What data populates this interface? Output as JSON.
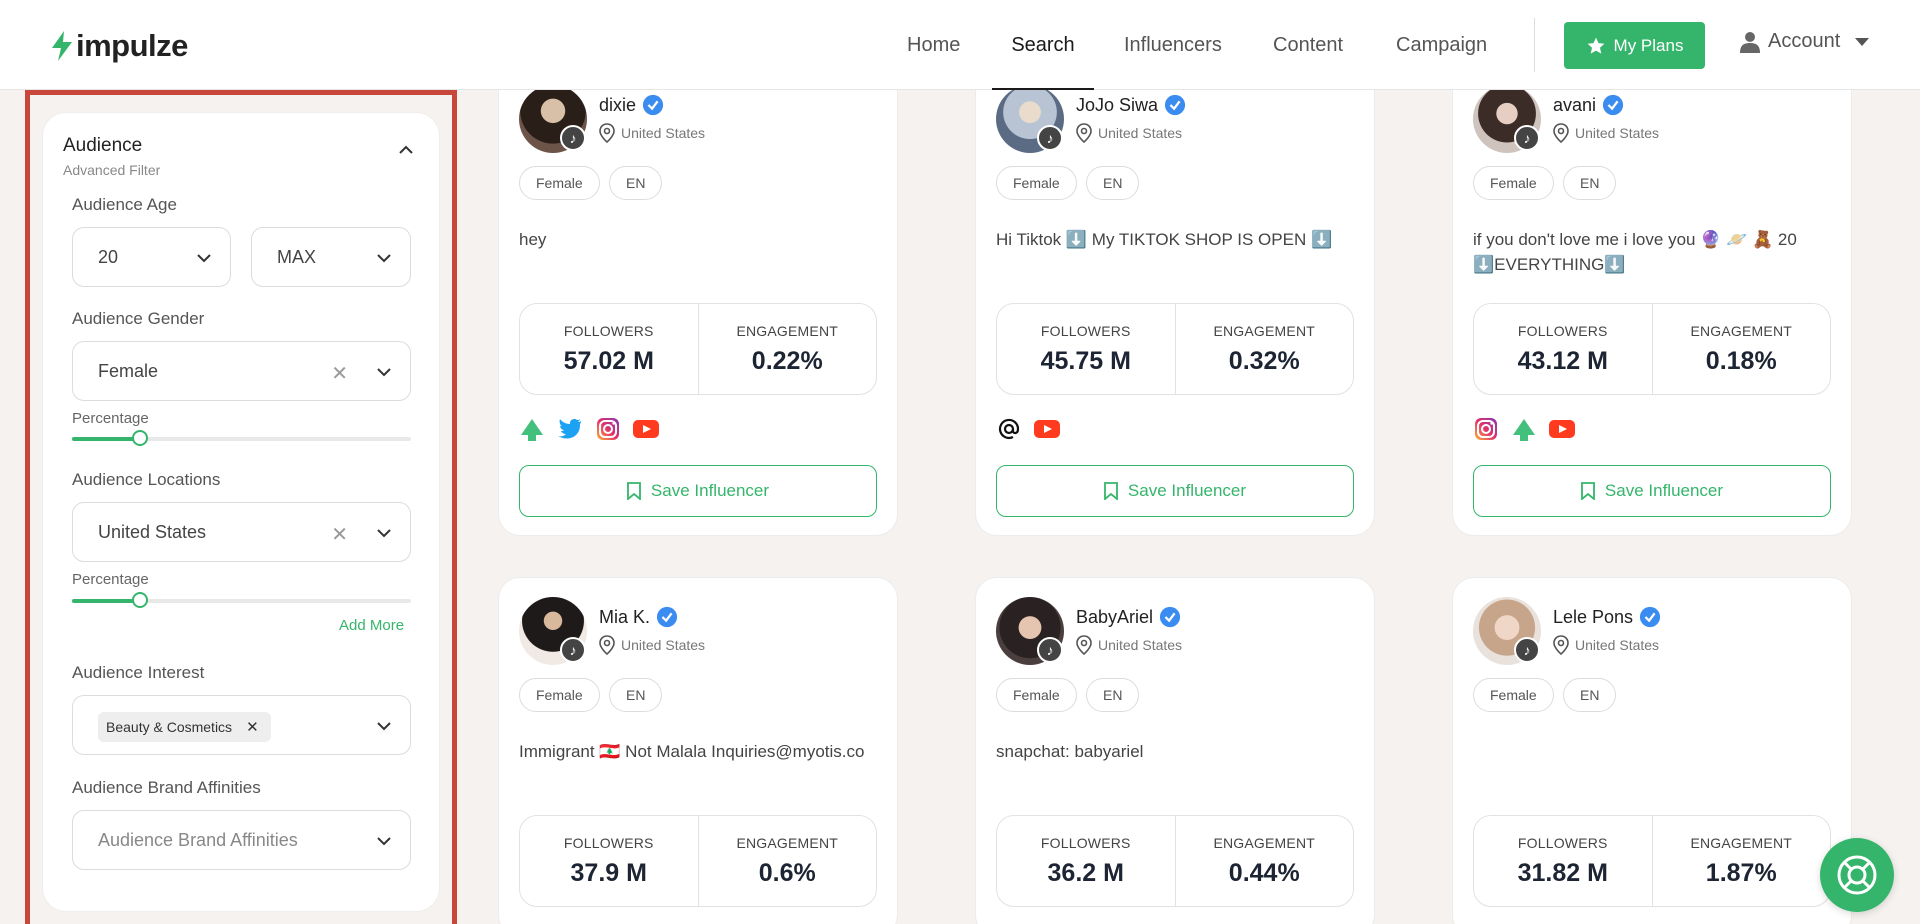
{
  "brand": {
    "name": "impulze",
    "accent": "#35b56b"
  },
  "nav": {
    "items": [
      "Home",
      "Search",
      "Influencers",
      "Content",
      "Campaign"
    ],
    "active": "Search",
    "plans_label": "My Plans",
    "account_label": "Account"
  },
  "filters": {
    "title": "Audience",
    "subtitle": "Advanced Filter",
    "age": {
      "label": "Audience Age",
      "min": "20",
      "max": "MAX"
    },
    "gender": {
      "label": "Audience Gender",
      "value": "Female",
      "percentage_label": "Percentage",
      "percentage": 0.2
    },
    "locations": {
      "label": "Audience Locations",
      "value": "United States",
      "percentage_label": "Percentage",
      "percentage": 0.2,
      "add_more": "Add More"
    },
    "interest": {
      "label": "Audience Interest",
      "chip": "Beauty & Cosmetics"
    },
    "brand_affinities": {
      "label": "Audience Brand Affinities",
      "placeholder": "Audience Brand Affinities"
    }
  },
  "labels": {
    "followers": "FOLLOWERS",
    "engagement": "ENGAGEMENT",
    "save": "Save Influencer"
  },
  "influencers": [
    {
      "name": "dixie",
      "location": "United States",
      "gender": "Female",
      "lang": "EN",
      "bio": "hey",
      "followers": "57.02 M",
      "engagement": "0.22%",
      "socials": [
        "linktree-icon",
        "twitter-icon",
        "instagram-icon",
        "youtube-icon"
      ]
    },
    {
      "name": "JoJo Siwa",
      "location": "United States",
      "gender": "Female",
      "lang": "EN",
      "bio": "Hi Tiktok ⬇️ My TIKTOK SHOP IS OPEN ⬇️",
      "followers": "45.75 M",
      "engagement": "0.32%",
      "socials": [
        "threads-icon",
        "youtube-icon"
      ]
    },
    {
      "name": "avani",
      "location": "United States",
      "gender": "Female",
      "lang": "EN",
      "bio": "if you don't love me i love you 🔮 🪐 🧸 20 ⬇️EVERYTHING⬇️",
      "followers": "43.12 M",
      "engagement": "0.18%",
      "socials": [
        "instagram-icon",
        "linktree-icon",
        "youtube-icon"
      ]
    },
    {
      "name": "Mia K.",
      "location": "United States",
      "gender": "Female",
      "lang": "EN",
      "bio": "Immigrant 🇱🇧 Not Malala Inquiries@myotis.co",
      "followers": "37.9 M",
      "engagement": "0.6%"
    },
    {
      "name": "BabyAriel",
      "location": "United States",
      "gender": "Female",
      "lang": "EN",
      "bio": "snapchat: babyariel",
      "followers": "36.2 M",
      "engagement": "0.44%"
    },
    {
      "name": "Lele Pons",
      "location": "United States",
      "gender": "Female",
      "lang": "EN",
      "bio": "",
      "followers": "31.82 M",
      "engagement": "1.87%"
    }
  ]
}
